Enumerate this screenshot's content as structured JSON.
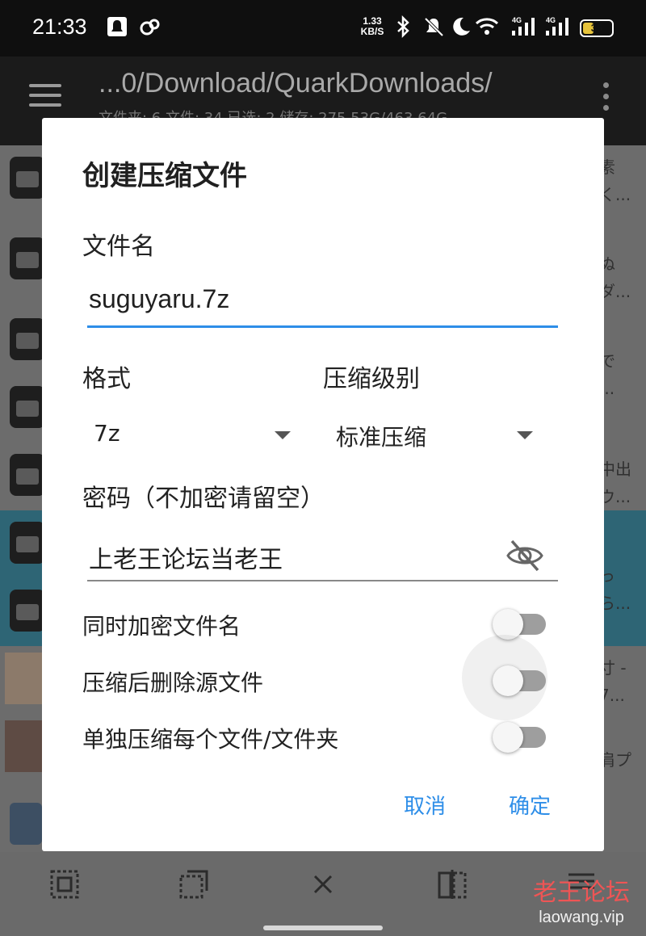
{
  "status_bar": {
    "time": "21:33",
    "net_speed_value": "1.33",
    "net_speed_unit": "KB/S",
    "battery": "35",
    "icons": [
      "notification-icon",
      "link-icon",
      "bluetooth-icon",
      "mute-icon",
      "moon-icon",
      "wifi-icon",
      "signal-4g-icon",
      "signal-4g-icon"
    ]
  },
  "app_bar": {
    "path": "...0/Download/QuarkDownloads/",
    "subtitle": "文件夹: 6  文件: 34  已选: 2  储存: 275.53G/463.64G"
  },
  "file_list": {
    "row_tails": [
      [
        "素",
        "く..."
      ],
      [
        "ぬ",
        "ダ..."
      ],
      [
        "で",
        "..."
      ],
      [
        "中出",
        "ウ..."
      ],
      [
        "っ",
        "ら..."
      ],
      [
        "寸 -",
        "7..."
      ],
      [
        "肩プ"
      ]
    ]
  },
  "dialog": {
    "title": "创建压缩文件",
    "filename_label": "文件名",
    "filename_value": "suguyaru.7z",
    "format_label": "格式",
    "format_value": "7z",
    "level_label": "压缩级别",
    "level_value": "标准压缩",
    "password_label": "密码（不加密请留空）",
    "password_value": "上老王论坛当老王",
    "switches": [
      {
        "label": "同时加密文件名",
        "on": false
      },
      {
        "label": "压缩后删除源文件",
        "on": false
      },
      {
        "label": "单独压缩每个文件/文件夹",
        "on": false
      }
    ],
    "cancel_label": "取消",
    "ok_label": "确定"
  },
  "bottom_bar": {
    "icons": [
      "select-all-icon",
      "select-range-icon",
      "close-icon",
      "invert-selection-icon",
      "list-icon"
    ]
  },
  "watermark": {
    "text": "老王论坛",
    "url": "laowang.vip"
  },
  "colors": {
    "accent": "#2e8ee8",
    "selected_row": "#2e6575",
    "watermark_red": "#e55555"
  }
}
